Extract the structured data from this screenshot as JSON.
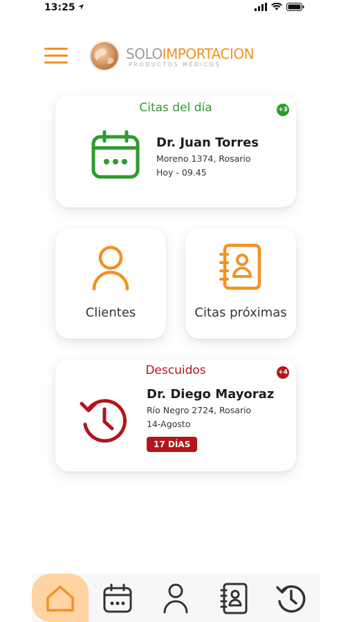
{
  "status_bar": {
    "time": "13:25"
  },
  "brand": {
    "word_part1": "SOLO",
    "word_part2": "IMPORTACION",
    "tagline": "PRODUCTOS MÉDICOS"
  },
  "appointments_today": {
    "title": "Citas del día",
    "badge": "+3",
    "doctor": "Dr. Juan Torres",
    "address": "Moreno 1374, Rosario",
    "time": "Hoy - 09.45"
  },
  "tiles": [
    {
      "label": "Clientes",
      "icon": "person-icon"
    },
    {
      "label": "Citas próximas",
      "icon": "contact-book-icon"
    }
  ],
  "missed": {
    "title": "Descuidos",
    "badge": "+4",
    "doctor": "Dr. Diego Mayoraz",
    "address": "Río Negro 2724, Rosario",
    "date": "14-Agosto",
    "days": "17 DÍAS"
  },
  "tab_bar": [
    "home-icon",
    "calendar-icon",
    "person-icon",
    "contact-book-icon",
    "history-icon"
  ],
  "colors": {
    "accent": "#f39121",
    "green": "#2e9b2e",
    "red": "#b3151b"
  }
}
